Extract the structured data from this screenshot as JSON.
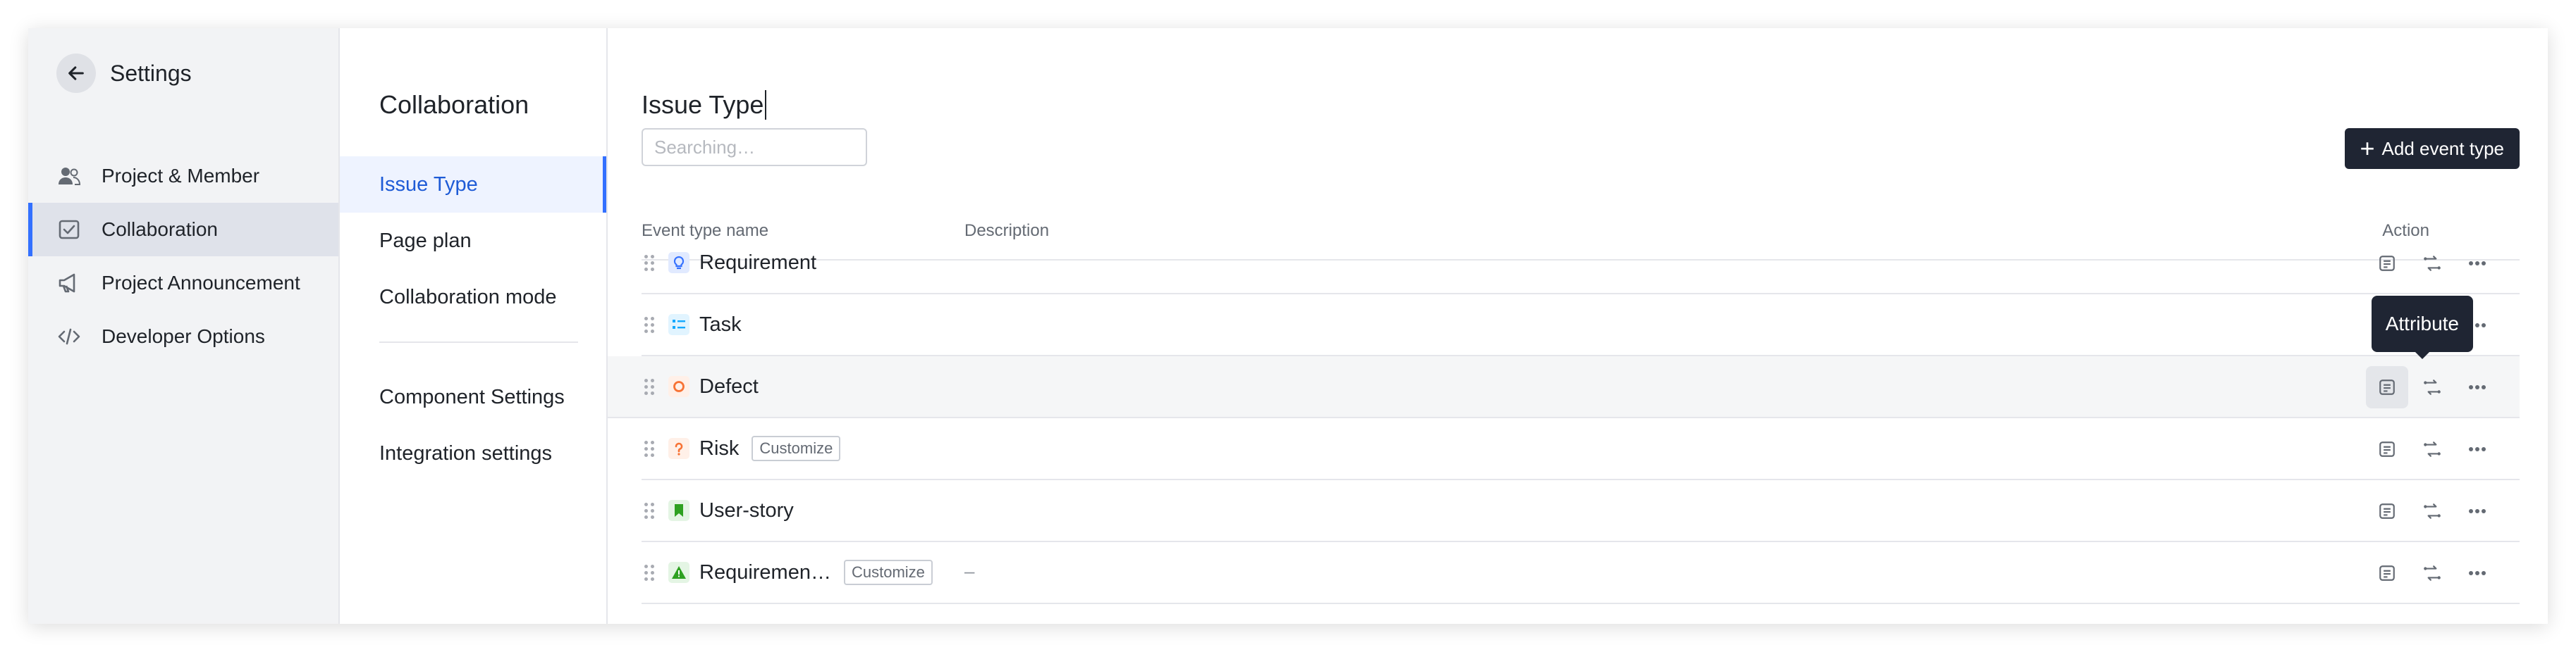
{
  "sidebar": {
    "title": "Settings",
    "items": [
      {
        "label": "Project & Member",
        "icon": "members-icon"
      },
      {
        "label": "Collaboration",
        "icon": "collaboration-icon",
        "active": true
      },
      {
        "label": "Project Announcement",
        "icon": "megaphone-icon"
      },
      {
        "label": "Developer Options",
        "icon": "code-icon"
      }
    ]
  },
  "subnav": {
    "title": "Collaboration",
    "items": [
      {
        "label": "Issue Type",
        "active": true
      },
      {
        "label": "Page plan"
      },
      {
        "label": "Collaboration mode"
      }
    ],
    "items2": [
      {
        "label": "Component Settings"
      },
      {
        "label": "Integration settings"
      }
    ]
  },
  "main": {
    "title": "Issue Type",
    "search_placeholder": "Searching…",
    "add_button": "Add event type",
    "columns": {
      "name": "Event type name",
      "description": "Description",
      "action": "Action"
    },
    "tooltip": "Attribute",
    "rows": [
      {
        "name": "Requirement",
        "icon": "lightbulb-icon",
        "icon_color": "#3370ff",
        "icon_bg": "#e1eaff",
        "tag": "",
        "description": ""
      },
      {
        "name": "Task",
        "icon": "list-icon",
        "icon_color": "#14a9ff",
        "icon_bg": "#e1f4ff",
        "tag": "",
        "description": ""
      },
      {
        "name": "Defect",
        "icon": "circle-icon",
        "icon_color": "#f77234",
        "icon_bg": "#fff0e8",
        "tag": "",
        "description": ""
      },
      {
        "name": "Risk",
        "icon": "question-icon",
        "icon_color": "#f77234",
        "icon_bg": "#fff0e8",
        "tag": "Customize",
        "description": ""
      },
      {
        "name": "User-story",
        "icon": "bookmark-icon",
        "icon_color": "#2ea121",
        "icon_bg": "#e4f5e4",
        "tag": "",
        "description": ""
      },
      {
        "name": "Requiremen…",
        "icon": "triangle-icon",
        "icon_color": "#2ea121",
        "icon_bg": "#e4f5e4",
        "tag": "Customize",
        "description": "–"
      }
    ]
  }
}
